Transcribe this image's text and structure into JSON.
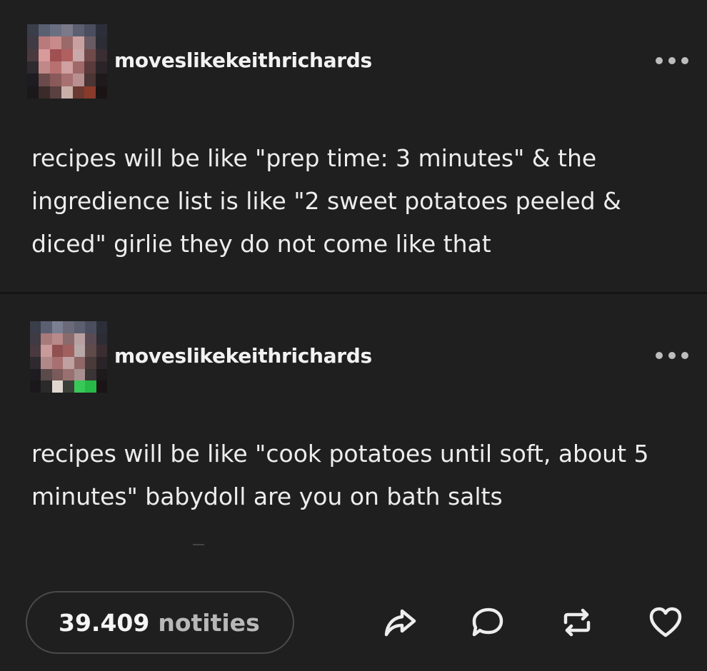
{
  "posts": [
    {
      "username": "moveslikekeithrichards",
      "text": "recipes will be like \"prep time: 3 minutes\" & the ingredience list is like \"2 sweet potatoes peeled & diced\" girlie they do not come like that"
    },
    {
      "username": "moveslikekeithrichards",
      "text": "recipes will be like \"cook potatoes until soft, about 5 minutes\" babydoll are you on bath salts"
    }
  ],
  "footer": {
    "notes_count": "39.409",
    "notes_label": "notities"
  },
  "icons": {
    "more": "more-horizontal-icon",
    "share": "share-icon",
    "reply": "reply-icon",
    "reblog": "reblog-icon",
    "like": "heart-icon"
  },
  "colors": {
    "background": "#1f1f1f",
    "text": "#f1f1f1",
    "muted": "#b8b8b8"
  }
}
